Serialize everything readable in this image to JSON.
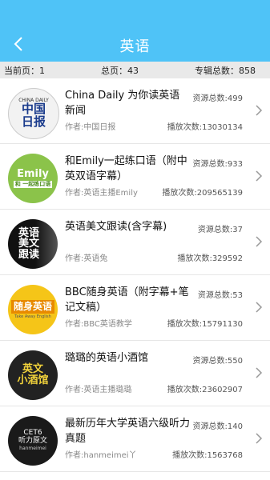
{
  "header": {
    "title": "英语"
  },
  "stats": {
    "current_page": "当前页：1",
    "total_pages": "总页：43",
    "total_albums": "专辑总数：858"
  },
  "items": [
    {
      "name": "China Daily 为你读英语新闻",
      "resources": "资源总数:499",
      "author": "作者:中国日报",
      "plays": "播放次数:13030134",
      "thumb_text": "中国\n日报",
      "thumb_caption": "CHINA DAILY"
    },
    {
      "name": "和Emily一起练口语（附中英双语字幕）",
      "resources": "资源总数:933",
      "author": "作者:英语主播Emily",
      "plays": "播放次数:209565139",
      "thumb_text": "Emily",
      "thumb_caption": "和 一起练口语"
    },
    {
      "name": "英语美文跟读(含字幕)",
      "resources": "资源总数:37",
      "author": "作者:英语兔",
      "plays": "播放次数:329592",
      "thumb_text": "英语\n美文\n跟读",
      "thumb_caption": ""
    },
    {
      "name": "BBC随身英语（附字幕+笔记文稿）",
      "resources": "资源总数:53",
      "author": "作者:BBC英语教学",
      "plays": "播放次数:15791130",
      "thumb_text": "随身英语",
      "thumb_caption": "Take Away English"
    },
    {
      "name": "璐璐的英语小酒馆",
      "resources": "资源总数:550",
      "author": "作者:英语主播璐璐",
      "plays": "播放次数:23602907",
      "thumb_text": "英文\n小酒馆",
      "thumb_caption": ""
    },
    {
      "name": "最新历年大学英语六级听力真题",
      "resources": "资源总数:140",
      "author": "作者:hanmeimei丫",
      "plays": "播放次数:1563768",
      "thumb_text": "CET6\n听力原文",
      "thumb_caption": "hanmeimei"
    }
  ],
  "colors": {
    "header": "#4fc3f7",
    "stats_bg": "#e9e9e9"
  },
  "icons": {
    "back": "chevron-left-icon",
    "row": "chevron-right-icon"
  }
}
